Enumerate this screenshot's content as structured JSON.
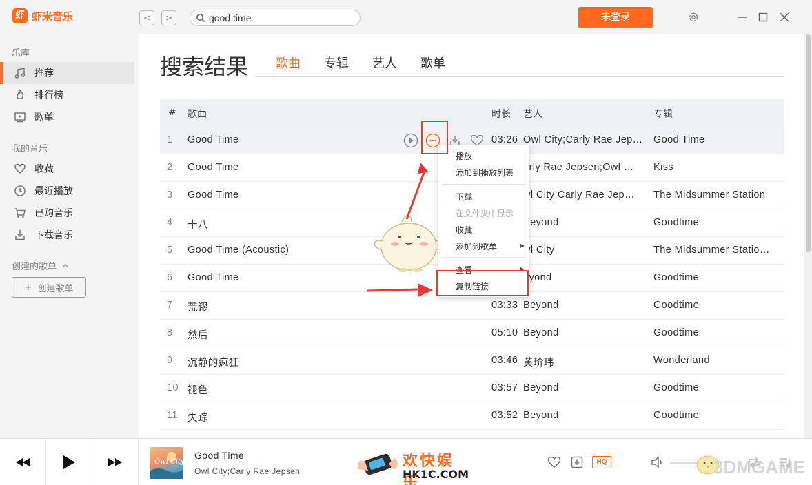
{
  "app": {
    "name": "虾米音乐",
    "logo_char": "虾"
  },
  "header": {
    "back_label": "<",
    "forward_label": ">",
    "search_value": "good time",
    "login_label": "未登录"
  },
  "sidebar": {
    "library_title": "乐库",
    "library_items": [
      {
        "label": "推荐",
        "icon": "music-note-icon",
        "active": true
      },
      {
        "label": "排行榜",
        "icon": "flame-icon"
      },
      {
        "label": "歌单",
        "icon": "screen-icon"
      }
    ],
    "my_music_title": "我的音乐",
    "my_music_items": [
      {
        "label": "收藏",
        "icon": "heart-icon"
      },
      {
        "label": "最近播放",
        "icon": "clock-icon"
      },
      {
        "label": "已购音乐",
        "icon": "cart-icon"
      },
      {
        "label": "下载音乐",
        "icon": "download-icon"
      }
    ],
    "created_title": "创建的歌单",
    "create_button": "创建歌单",
    "create_plus": "+"
  },
  "main": {
    "title": "搜索结果",
    "tabs": [
      {
        "label": "歌曲",
        "active": true
      },
      {
        "label": "专辑"
      },
      {
        "label": "艺人"
      },
      {
        "label": "歌单"
      }
    ],
    "columns": {
      "num": "#",
      "song": "歌曲",
      "duration": "时长",
      "artist": "艺人",
      "album": "专辑"
    },
    "rows": [
      {
        "num": "1",
        "song": "Good Time",
        "duration": "03:26",
        "artist": "Owl City;Carly Rae Jep…",
        "album": "Good Time"
      },
      {
        "num": "2",
        "song": "Good Time",
        "duration": "",
        "artist": "arly Rae Jepsen;Owl …",
        "album": "Kiss"
      },
      {
        "num": "3",
        "song": "Good Time",
        "duration": "",
        "artist": "wl City;Carly Rae Jep…",
        "album": "The Midsummer Station"
      },
      {
        "num": "4",
        "song": "十八",
        "duration": "",
        "artist": "Beyond",
        "album": "Goodtime"
      },
      {
        "num": "5",
        "song": "Good Time (Acoustic)",
        "duration": "",
        "artist": "wl City",
        "album": "The Midsummer Statio…"
      },
      {
        "num": "6",
        "song": "Good Time",
        "duration": "",
        "artist": "eyond",
        "album": "Goodtime"
      },
      {
        "num": "7",
        "song": "荒谬",
        "duration": "03:33",
        "artist": "Beyond",
        "album": "Goodtime"
      },
      {
        "num": "8",
        "song": "然后",
        "duration": "05:10",
        "artist": "Beyond",
        "album": "Goodtime"
      },
      {
        "num": "9",
        "song": "沉静的疯狂",
        "duration": "03:46",
        "artist": "黄玠玮",
        "album": "Wonderland"
      },
      {
        "num": "10",
        "song": "褪色",
        "duration": "03:57",
        "artist": "Beyond",
        "album": "Goodtime"
      },
      {
        "num": "11",
        "song": "失踪",
        "duration": "03:52",
        "artist": "Beyond",
        "album": "Goodtime"
      }
    ]
  },
  "context_menu": {
    "play": "播放",
    "add_to_queue": "添加到播放列表",
    "download": "下载",
    "show_in_folder": "在文件夹中显示",
    "collect": "收藏",
    "add_to_playlist": "添加到歌单",
    "view": "查看",
    "copy_link": "复制链接"
  },
  "player": {
    "title": "Good Time",
    "artist": "Owl City;Carly Rae Jepsen",
    "quality_badge": "HQ",
    "album_text": "Owl City"
  },
  "watermarks": {
    "hk_title": "欢快娱乐",
    "hk_domain": "HK1C.COM",
    "game_brand": "3DMGAME"
  },
  "colors": {
    "accent": "#ff6a1f",
    "annotation": "#e53935"
  }
}
